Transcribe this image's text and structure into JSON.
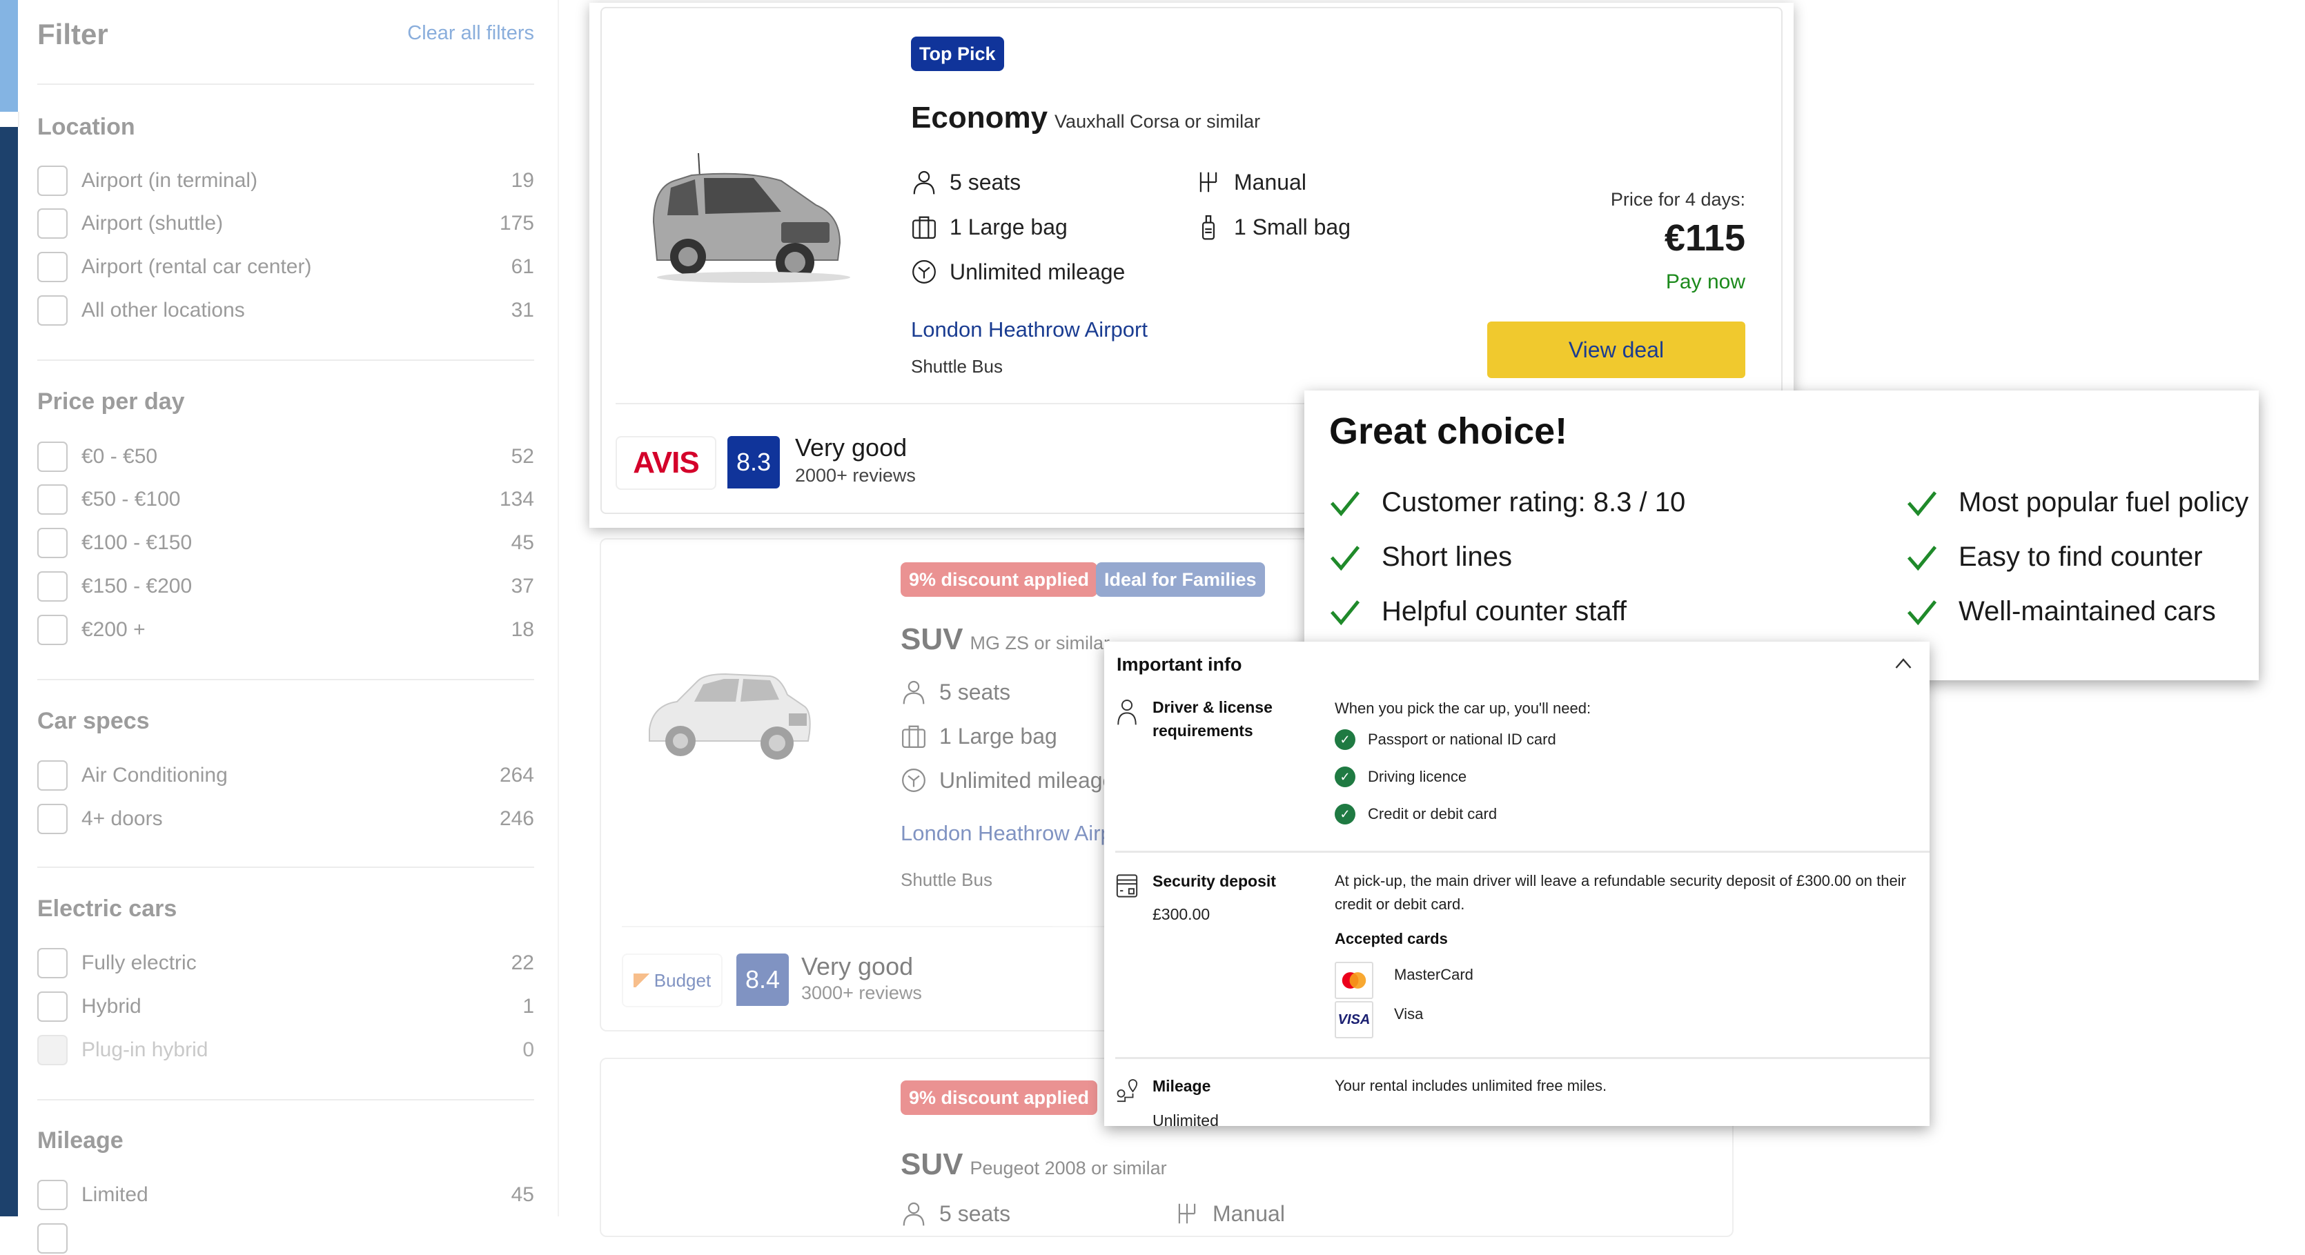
{
  "sidebar": {
    "title": "Filter",
    "clear_all": "Clear all filters",
    "sections": [
      {
        "title": "Location",
        "options": [
          {
            "label": "Airport (in terminal)",
            "count": "19"
          },
          {
            "label": "Airport (shuttle)",
            "count": "175"
          },
          {
            "label": "Airport (rental car center)",
            "count": "61"
          },
          {
            "label": "All other locations",
            "count": "31"
          }
        ]
      },
      {
        "title": "Price per day",
        "options": [
          {
            "label": "€0 - €50",
            "count": "52"
          },
          {
            "label": "€50 - €100",
            "count": "134"
          },
          {
            "label": "€100 - €150",
            "count": "45"
          },
          {
            "label": "€150 - €200",
            "count": "37"
          },
          {
            "label": "€200 +",
            "count": "18"
          }
        ]
      },
      {
        "title": "Car specs",
        "options": [
          {
            "label": "Air Conditioning",
            "count": "264"
          },
          {
            "label": "4+ doors",
            "count": "246"
          }
        ]
      },
      {
        "title": "Electric cars",
        "options": [
          {
            "label": "Fully electric",
            "count": "22"
          },
          {
            "label": "Hybrid",
            "count": "1"
          },
          {
            "label": "Plug-in hybrid",
            "count": "0",
            "disabled": true
          }
        ]
      },
      {
        "title": "Mileage",
        "options": [
          {
            "label": "Limited",
            "count": "45"
          }
        ]
      }
    ]
  },
  "card1": {
    "badge": "Top Pick",
    "category": "Economy",
    "model": "Vauxhall Corsa or similar",
    "specs": {
      "seats": "5 seats",
      "transmission": "Manual",
      "large_bag": "1 Large bag",
      "small_bag": "1 Small bag",
      "mileage": "Unlimited mileage"
    },
    "location": "London Heathrow Airport",
    "location_sub": "Shuttle Bus",
    "price_label": "Price for 4 days:",
    "price": "€115",
    "pay_label": "Pay now",
    "view_deal": "View deal",
    "supplier": "AVIS",
    "score": "8.3",
    "rating_word": "Very good",
    "rating_count": "2000+ reviews"
  },
  "card2": {
    "badges": [
      "9% discount applied",
      "Ideal for Families"
    ],
    "category": "SUV",
    "model": "MG ZS or similar",
    "specs": {
      "seats": "5 seats",
      "large_bag": "1 Large bag",
      "mileage": "Unlimited mileage"
    },
    "location": "London Heathrow Airport",
    "location_sub": "Shuttle Bus",
    "supplier": "Budget",
    "score": "8.4",
    "rating_word": "Very good",
    "rating_count": "3000+ reviews"
  },
  "card3": {
    "badge": "9% discount applied",
    "category": "SUV",
    "model": "Peugeot 2008 or similar",
    "specs": {
      "seats": "5 seats",
      "transmission": "Manual"
    }
  },
  "great_choice": {
    "title": "Great choice!",
    "items": [
      "Customer rating: 8.3 / 10",
      "Short lines",
      "Helpful counter staff",
      "Most popular fuel policy",
      "Easy to find counter",
      "Well-maintained cars"
    ]
  },
  "important_info": {
    "title": "Important info",
    "driver": {
      "label": "Driver & license requirements",
      "intro": "When you pick the car up, you'll need:",
      "items": [
        "Passport or national ID card",
        "Driving licence",
        "Credit or debit card"
      ]
    },
    "deposit": {
      "label": "Security deposit",
      "amount": "£300.00",
      "text": "At pick-up, the main driver will leave a refundable security deposit of £300.00 on their credit or debit card.",
      "accepted_title": "Accepted cards",
      "cards": [
        "MasterCard",
        "Visa"
      ]
    },
    "mileage": {
      "label": "Mileage",
      "sub": "Unlimited",
      "text": "Your rental includes unlimited free miles."
    }
  },
  "colors": {
    "brand_dark": "#1d416c",
    "top_pick": "#10349a",
    "cta_yellow": "#f0c92e",
    "pay_green": "#1c8a1c",
    "discount_red": "#d93a3a",
    "families_blue": "#3f62a8",
    "avis_red": "#d4002a"
  }
}
